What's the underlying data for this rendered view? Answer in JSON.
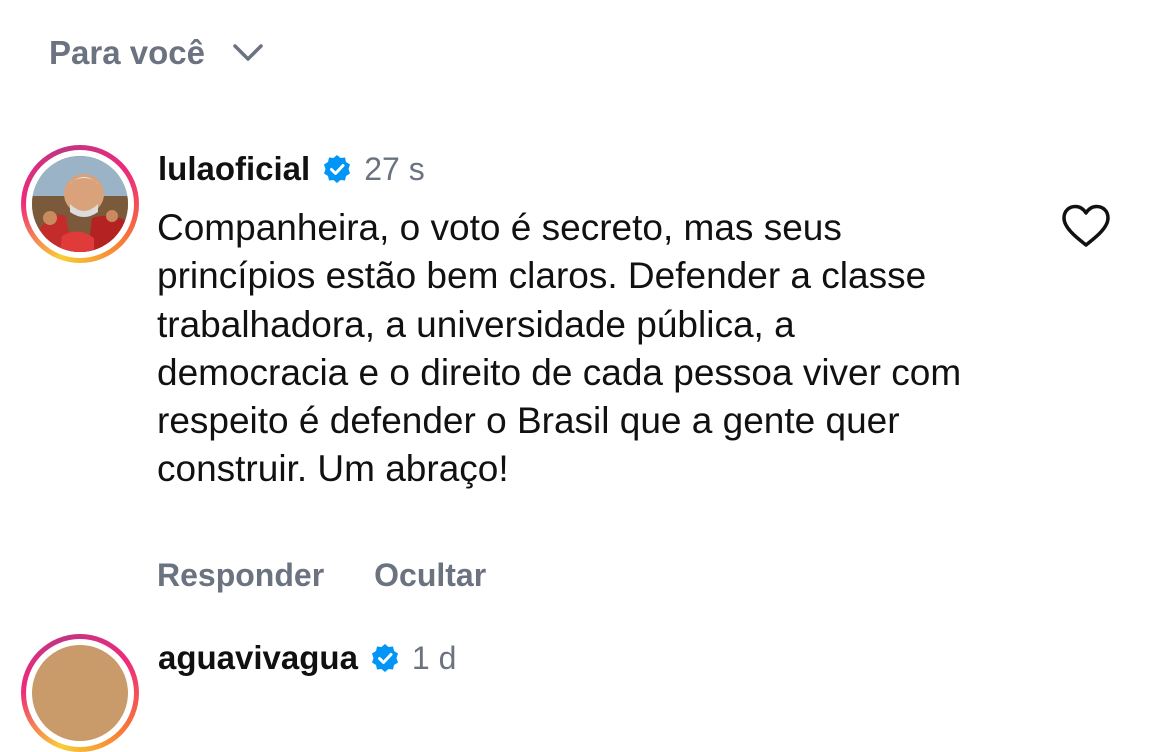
{
  "feed": {
    "filter_label": "Para você"
  },
  "comments": [
    {
      "username": "lulaoficial",
      "time": "27 s",
      "text": "Companheira, o voto é secreto, mas seus princípios estão bem claros. Defender a classe trabalhadora, a universidade pública, a democracia e o direito de cada pessoa viver com respeito é defender o Brasil que a gente quer construir. Um abraço!",
      "reply_label": "Responder",
      "hide_label": "Ocultar"
    },
    {
      "username": "aguavivagua",
      "time": "1 d"
    }
  ],
  "colors": {
    "verified": "#0095f6",
    "muted": "#6b7280",
    "text": "#111111"
  }
}
